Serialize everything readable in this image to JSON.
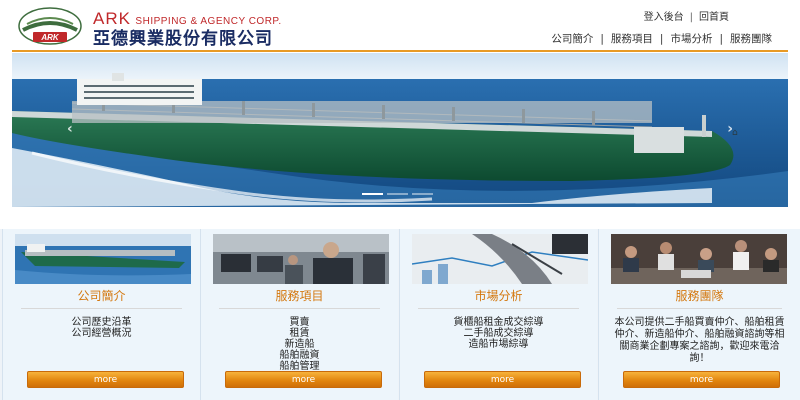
{
  "header": {
    "brand_en_big": "ARK",
    "brand_en_small": "SHIPPING & AGENCY CORP.",
    "brand_zh": "亞德興業股份有限公司",
    "logo_text": "ARK",
    "top_links": [
      "登入後台",
      "回首頁"
    ],
    "nav": [
      "公司簡介",
      "服務項目",
      "市場分析",
      "服務團隊"
    ]
  },
  "banner": {
    "prev_icon": "chevron-left",
    "next_icon": "chevron-right",
    "slide_count": 3,
    "active_slide": 1
  },
  "cards": [
    {
      "title": "公司簡介",
      "lines": [
        "公司歷史沿革",
        "公司經營概況"
      ],
      "button": "more"
    },
    {
      "title": "服務項目",
      "lines": [
        "買賣",
        "租賃",
        "新造船",
        "船舶融資",
        "船舶管理"
      ],
      "button": "more"
    },
    {
      "title": "市場分析",
      "lines": [
        "貨櫃船租金成交綜導",
        "二手船成交綜導",
        "造船市場綜導"
      ],
      "button": "more"
    },
    {
      "title": "服務團隊",
      "desc": "本公司提供二手船買賣仲介、船舶租賃仲介、新造船仲介、船舶融資諮詢等相關商業企劃專案之諮詢，歡迎來電洽詢！",
      "button": "more"
    }
  ],
  "colors": {
    "accent": "#e89a25",
    "brand_red": "#c0282a",
    "brand_navy": "#1a2c63",
    "card_title": "#d4780f"
  }
}
